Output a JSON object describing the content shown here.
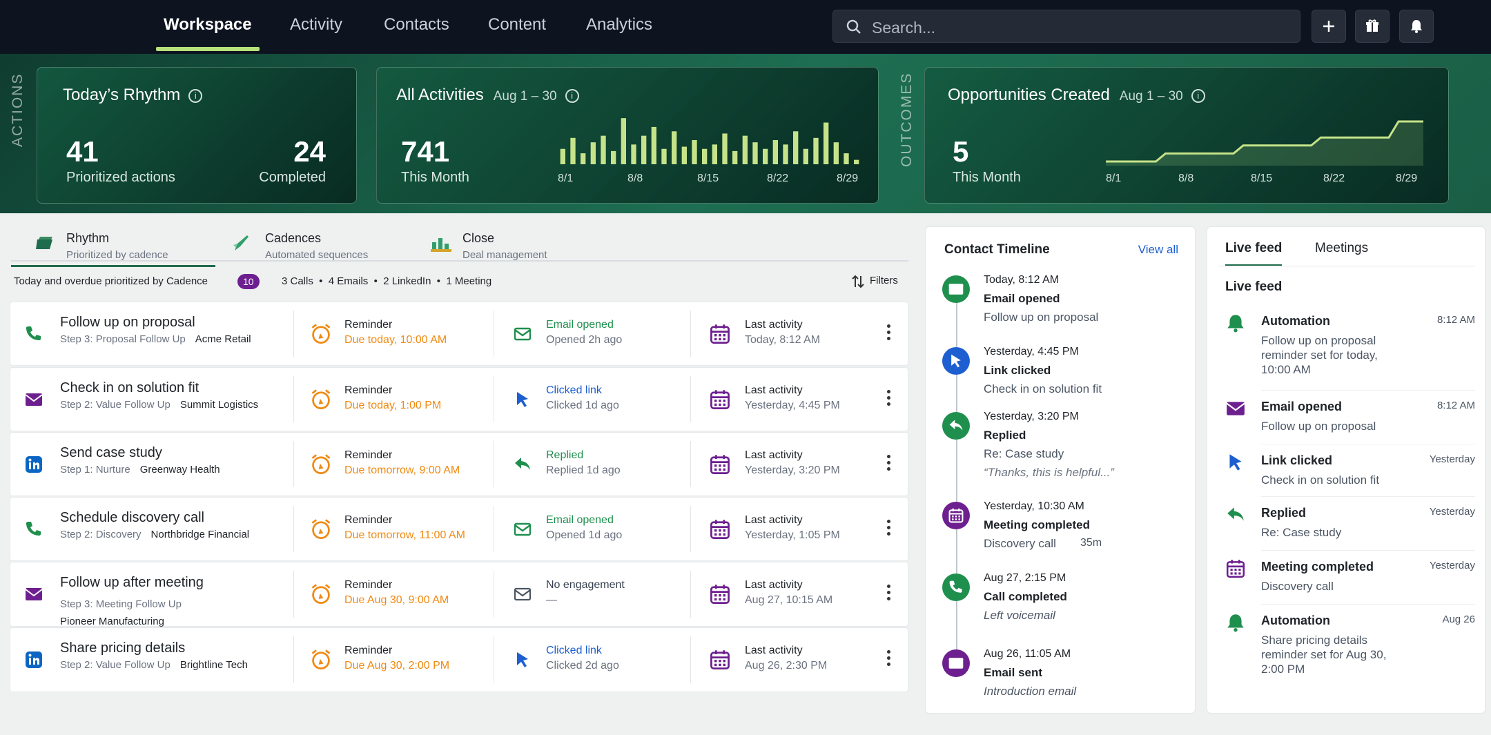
{
  "nav": {
    "tabs": [
      "Workspace",
      "Activity",
      "Contacts",
      "Content",
      "Analytics"
    ],
    "search_placeholder": "Search...",
    "icons": [
      "plus-icon",
      "gift-icon",
      "bell-icon"
    ]
  },
  "hero": {
    "actions_label": "ACTIONS",
    "outcomes_label": "OUTCOMES",
    "rhythm": {
      "title": "Today’s Rhythm",
      "prioritized": "41",
      "prioritized_label": "Prioritized actions",
      "completed": "24",
      "completed_label": "Completed"
    },
    "activities": {
      "title": "All Activities",
      "range": "Aug 1 – 30",
      "value": "741",
      "value_label": "This Month",
      "ticks": [
        "8/1",
        "8/8",
        "8/15",
        "8/22",
        "8/29"
      ]
    },
    "opportunities": {
      "title": "Opportunities Created",
      "range": "Aug 1 – 30",
      "value": "5",
      "value_label": "This Month",
      "ticks": [
        "8/1",
        "8/8",
        "8/15",
        "8/22",
        "8/29"
      ]
    }
  },
  "chart_data": [
    {
      "type": "bar",
      "title": "All Activities",
      "x": [
        "8/1",
        "8/2",
        "8/3",
        "8/4",
        "8/5",
        "8/6",
        "8/7",
        "8/8",
        "8/9",
        "8/10",
        "8/11",
        "8/12",
        "8/13",
        "8/14",
        "8/15",
        "8/16",
        "8/17",
        "8/18",
        "8/19",
        "8/20",
        "8/21",
        "8/22",
        "8/23",
        "8/24",
        "8/25",
        "8/26",
        "8/27",
        "8/28",
        "8/29",
        "8/30"
      ],
      "values": [
        14,
        24,
        10,
        20,
        26,
        12,
        42,
        18,
        26,
        34,
        14,
        30,
        16,
        22,
        14,
        18,
        28,
        12,
        26,
        20,
        14,
        22,
        18,
        30,
        14,
        24,
        38,
        20,
        10,
        4
      ],
      "xlabel": "",
      "ylabel": ""
    },
    {
      "type": "area",
      "title": "Opportunities Created",
      "x": [
        "8/1",
        "8/8",
        "8/15",
        "8/22",
        "8/29"
      ],
      "values": [
        0,
        1,
        2,
        3,
        5
      ],
      "xlabel": "",
      "ylabel": ""
    }
  ],
  "tabs": [
    {
      "label": "Rhythm",
      "sub": "Prioritized by cadence"
    },
    {
      "label": "Cadences",
      "sub": "Automated sequences"
    },
    {
      "label": "Close",
      "sub": "Deal management"
    }
  ],
  "summary": {
    "text": "Today and overdue prioritized by Cadence",
    "count": "10",
    "stats": "3 Calls  •  4 Emails  •  2 LinkedIn  •  1 Meeting",
    "filters": "Filters"
  },
  "rows": [
    {
      "title": "Follow up on proposal",
      "step": "Step 3: Proposal Follow Up",
      "company": "Acme Retail",
      "icon": "phone-icon",
      "reminder": "Reminder",
      "due": "Due today, 10:00 AM",
      "eng_icon": "mail-outline-icon",
      "eng": "Email opened",
      "eng_sub": "Opened 2h ago",
      "eng_color": "#1f8f4e",
      "last": "Last activity",
      "last_sub": "Today, 8:12 AM"
    },
    {
      "title": "Check in on solution fit",
      "step": "Step 2: Value Follow Up",
      "company": "Summit Logistics",
      "icon": "mail-icon",
      "reminder": "Reminder",
      "due": "Due today, 1:00 PM",
      "eng_icon": "cursor-icon",
      "eng": "Clicked link",
      "eng_sub": "Clicked 1d ago",
      "eng_color": "#1d5fd1",
      "last": "Last activity",
      "last_sub": "Yesterday, 4:45 PM"
    },
    {
      "title": "Send case study",
      "step": "Step 1: Nurture",
      "company": "Greenway Health",
      "icon": "linkedin-icon",
      "reminder": "Reminder",
      "due": "Due tomorrow, 9:00 AM",
      "eng_icon": "reply-icon",
      "eng": "Replied",
      "eng_sub": "Replied 1d ago",
      "eng_color": "#1f8f4e",
      "last": "Last activity",
      "last_sub": "Yesterday, 3:20 PM"
    },
    {
      "title": "Schedule discovery call",
      "step": "Step 2: Discovery",
      "company": "Northbridge Financial",
      "icon": "phone-icon",
      "reminder": "Reminder",
      "due": "Due tomorrow, 11:00 AM",
      "eng_icon": "mail-outline-icon",
      "eng": "Email opened",
      "eng_sub": "Opened 1d ago",
      "eng_color": "#1f8f4e",
      "last": "Last activity",
      "last_sub": "Yesterday, 1:05 PM"
    },
    {
      "title": "Follow up after meeting",
      "step": "Step 3: Meeting Follow Up",
      "company": "Pioneer Manufacturing",
      "icon": "mail-icon",
      "reminder": "Reminder",
      "due": "Due Aug 30, 9:00 AM",
      "eng_icon": "mail-gray-icon",
      "eng": "No engagement",
      "eng_sub": "—",
      "eng_color": "#374151",
      "last": "Last activity",
      "last_sub": "Aug 27, 10:15 AM"
    },
    {
      "title": "Share pricing details",
      "step": "Step 2: Value Follow Up",
      "company": "Brightline Tech",
      "icon": "linkedin-icon",
      "reminder": "Reminder",
      "due": "Due Aug 30, 2:00 PM",
      "eng_icon": "cursor-icon",
      "eng": "Clicked link",
      "eng_sub": "Clicked 2d ago",
      "eng_color": "#1d5fd1",
      "last": "Last activity",
      "last_sub": "Aug 26, 2:30 PM"
    }
  ],
  "timeline": {
    "title": "Contact Timeline",
    "view_all": "View all",
    "items": [
      {
        "time": "Today, 8:12 AM",
        "event": "Email opened",
        "detail": "Follow up on proposal",
        "italic": false,
        "icon": "mail-icon",
        "color": "#1f8f4e"
      },
      {
        "time": "Yesterday, 4:45 PM",
        "event": "Link clicked",
        "detail": "Check in on solution fit",
        "italic": false,
        "icon": "cursor-icon",
        "color": "#1d5fd1"
      },
      {
        "time": "Yesterday, 3:20 PM",
        "event": "Replied",
        "detail": "Re: Case study",
        "detail2": "“Thanks, this is helpful...”",
        "italic": false,
        "icon": "reply-icon",
        "color": "#1f8f4e"
      },
      {
        "time": "Yesterday, 10:30 AM",
        "event": "Meeting completed",
        "detail": "Discovery call",
        "detail_extra": "35m",
        "italic": false,
        "icon": "calendar-icon",
        "color": "#6d1f8f"
      },
      {
        "time": "Aug 27, 2:15 PM",
        "event": "Call completed",
        "detail": "Left voicemail",
        "italic": true,
        "icon": "phone-icon",
        "color": "#1f8f4e"
      },
      {
        "time": "Aug 26, 11:05 AM",
        "event": "Email sent",
        "detail": "Introduction email",
        "italic": true,
        "icon": "mail-icon",
        "color": "#6d1f8f"
      }
    ]
  },
  "livefeed": {
    "tabs": [
      "Live feed",
      "Meetings"
    ],
    "heading": "Live feed",
    "items": [
      {
        "title": "Automation",
        "time": "8:12 AM",
        "detail": "Follow up on proposal reminder set for today, 10:00 AM",
        "icon": "bell-icon"
      },
      {
        "title": "Email opened",
        "time": "8:12 AM",
        "detail": "Follow up on proposal",
        "icon": "mail-icon"
      },
      {
        "title": "Link clicked",
        "time": "Yesterday",
        "detail": "Check in on solution fit",
        "icon": "cursor-icon"
      },
      {
        "title": "Replied",
        "time": "Yesterday",
        "detail": "Re: Case study",
        "icon": "reply-icon"
      },
      {
        "title": "Meeting completed",
        "time": "Yesterday",
        "detail": "Discovery call",
        "icon": "calendar-icon"
      },
      {
        "title": "Automation",
        "time": "Aug 26",
        "detail": "Share pricing details reminder set for Aug 30, 2:00 PM",
        "icon": "bell-icon"
      }
    ]
  }
}
